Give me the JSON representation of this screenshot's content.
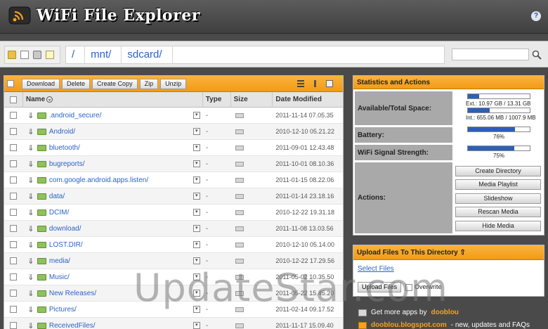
{
  "header": {
    "title": "WiFi File Explorer",
    "help_icon": "help-icon"
  },
  "pathbar": {
    "nav_icons": [
      "folder-icon",
      "document-icon",
      "lock-icon",
      "note-icon"
    ],
    "crumbs": [
      "/",
      "mnt/",
      "sdcard/"
    ],
    "search_value": "",
    "search_icon": "search-icon"
  },
  "toolbar": {
    "download_label": "Download",
    "delete_label": "Delete",
    "create_copy_label": "Create Copy",
    "zip_label": "Zip",
    "unzip_label": "Unzip"
  },
  "table": {
    "headers": {
      "name": "Name",
      "type": "Type",
      "size": "Size",
      "date": "Date Modified"
    },
    "rows": [
      {
        "name": ".android_secure/",
        "type": "-",
        "date": "2011-11-14 07.05.35"
      },
      {
        "name": "Android/",
        "type": "-",
        "date": "2010-12-10 05.21.22"
      },
      {
        "name": "bluetooth/",
        "type": "-",
        "date": "2011-09-01 12.43.48"
      },
      {
        "name": "bugreports/",
        "type": "-",
        "date": "2011-10-01 08.10.36"
      },
      {
        "name": "com.google.android.apps.listen/",
        "type": "-",
        "date": "2011-01-15 08.22.06"
      },
      {
        "name": "data/",
        "type": "-",
        "date": "2011-01-14 23.18.16"
      },
      {
        "name": "DCIM/",
        "type": "-",
        "date": "2010-12-22 19.31.18"
      },
      {
        "name": "download/",
        "type": "-",
        "date": "2011-11-08 13.03.56"
      },
      {
        "name": "LOST.DIR/",
        "type": "-",
        "date": "2010-12-10 05.14.00"
      },
      {
        "name": "media/",
        "type": "-",
        "date": "2010-12-22 17.29.56"
      },
      {
        "name": "Music/",
        "type": "-",
        "date": "2011-05-02 10.35.50"
      },
      {
        "name": "New Releases/",
        "type": "-",
        "date": "2011-05-22 15.45.20"
      },
      {
        "name": "Pictures/",
        "type": "-",
        "date": "2011-02-14 09.17.52"
      },
      {
        "name": "ReceivedFiles/",
        "type": "-",
        "date": "2011-11-17 15.09.40"
      }
    ]
  },
  "stats": {
    "heading": "Statistics and Actions",
    "space_label": "Available/Total Space:",
    "space_ext": "Ext.: 10.97 GB / 13.31 GB",
    "space_ext_used": 0.18,
    "space_int": "Int.: 655.06 MB / 1007.9 MB",
    "space_int_used": 0.35,
    "battery_label": "Battery:",
    "battery_value": "76%",
    "battery_level": 0.76,
    "wifi_label": "WiFi Signal Strength:",
    "wifi_value": "75%",
    "wifi_level": 0.75,
    "actions_label": "Actions:",
    "actions": [
      "Create Directory",
      "Media Playlist",
      "Slideshow",
      "Rescan Media",
      "Hide Media"
    ]
  },
  "upload": {
    "heading": "Upload Files To This Directory",
    "select_files": "Select Files",
    "upload_button": "Upload Files",
    "overwrite_label": "Overwrite"
  },
  "footer": {
    "line1_text": "Get more apps by",
    "line1_link": "dooblou",
    "line2_link": "dooblou.blogspot.com",
    "line2_text": "- new, updates and FAQs"
  },
  "watermark": "UpdateStar.com"
}
